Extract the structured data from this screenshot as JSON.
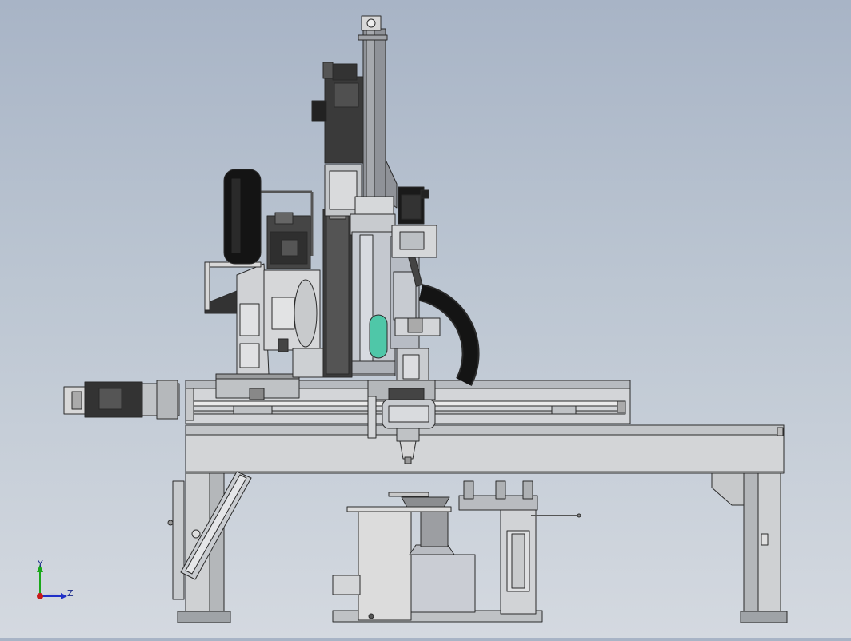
{
  "view": {
    "background_top": "#a8b4c6",
    "background_bottom": "#d4d9e0"
  },
  "triad": {
    "y_label": "Y",
    "z_label": "Z",
    "y_color": "#1aa81a",
    "z_color": "#2030c8",
    "x_color": "#c81a1a"
  },
  "colors": {
    "frame": "#d2d4d6",
    "frame_dark": "#a9acaf",
    "steel": "#c2c6cc",
    "dark_motor": "#3a3a3a",
    "black": "#141414",
    "accent_teal": "#4fc7a8",
    "outline": "#2a2a2a"
  }
}
